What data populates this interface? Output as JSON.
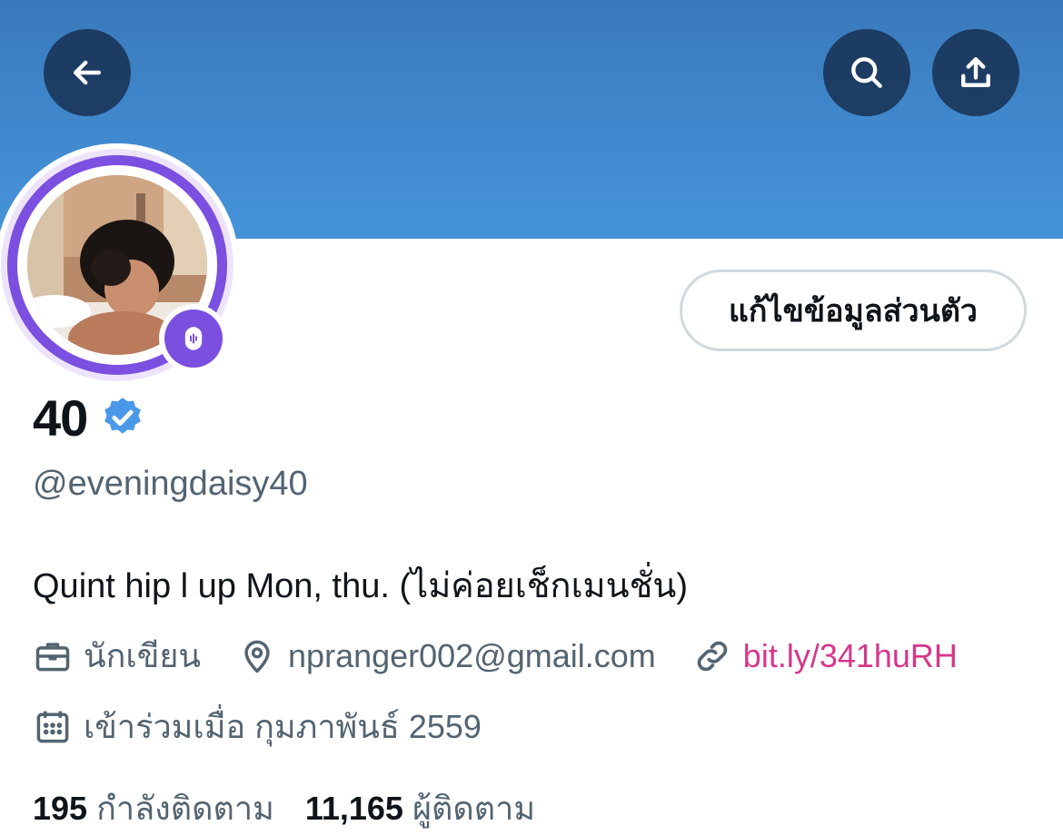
{
  "header": {
    "back_icon": "arrow-left-icon",
    "search_icon": "search-icon",
    "share_icon": "share-upload-icon",
    "banner_color": "#4190d6"
  },
  "profile": {
    "display_name": "40",
    "verified_badge_color": "#4a99e9",
    "handle": "@eveningdaisy40",
    "edit_button_label": "แก้ไขข้อมูลส่วนตัว",
    "bio": "Quint hip l up Mon, thu. (ไม่ค่อยเช็กเมนชั่น)",
    "spaces_ring_color": "#7b4fe0"
  },
  "meta": {
    "profession": "นักเขียน",
    "location": "npranger002@gmail.com",
    "link": "bit.ly/341huRH",
    "joined": "เข้าร่วมเมื่อ กุมภาพันธ์ 2559"
  },
  "stats": {
    "following_count": "195",
    "following_label": "กำลังติดตาม",
    "followers_count": "11,165",
    "followers_label": "ผู้ติดตาม"
  },
  "colors": {
    "link": "#d6378a",
    "secondary_text": "#536471",
    "primary_text": "#0f1419"
  }
}
